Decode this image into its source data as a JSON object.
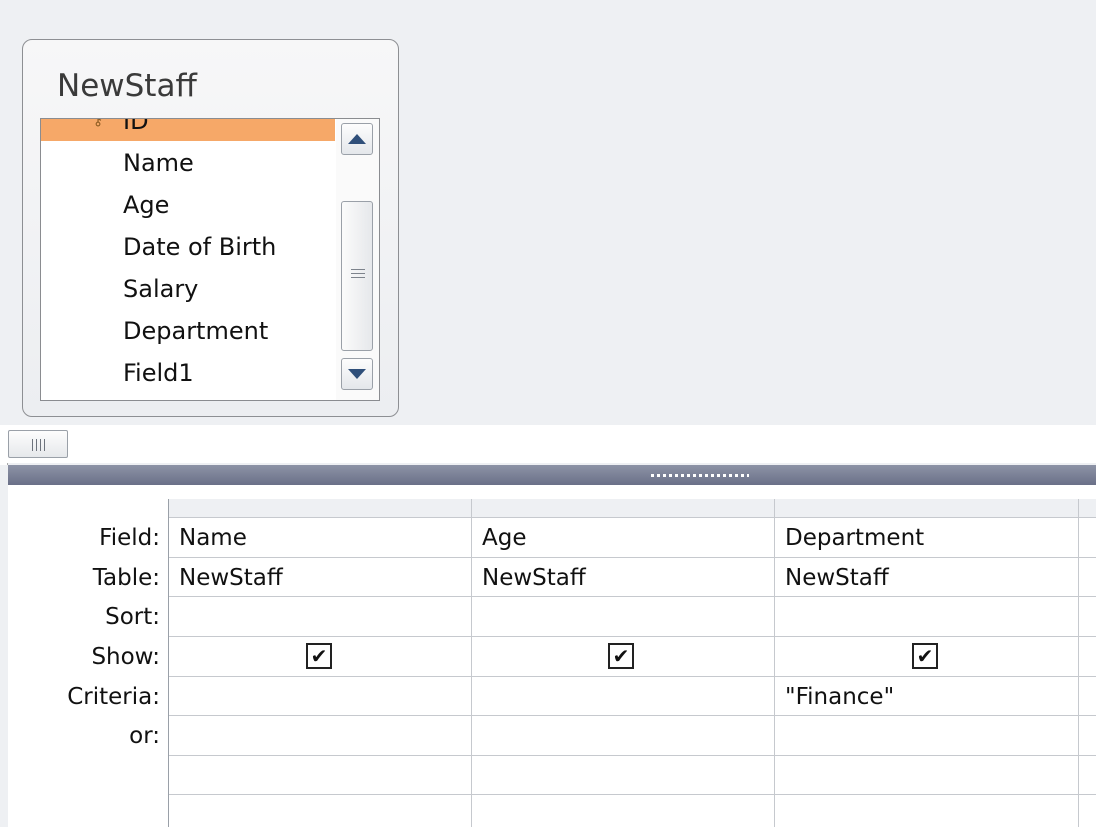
{
  "table_box": {
    "title": "NewStaff",
    "fields": [
      "ID",
      "Name",
      "Age",
      "Date of Birth",
      "Salary",
      "Department",
      "Field1"
    ],
    "selected_field": "ID"
  },
  "grid": {
    "row_labels": [
      "Field:",
      "Table:",
      "Sort:",
      "Show:",
      "Criteria:",
      "or:"
    ],
    "columns": [
      {
        "field": "Name",
        "table": "NewStaff",
        "sort": "",
        "show": true,
        "criteria": "",
        "or": ""
      },
      {
        "field": "Age",
        "table": "NewStaff",
        "sort": "",
        "show": true,
        "criteria": "",
        "or": ""
      },
      {
        "field": "Department",
        "table": "NewStaff",
        "sort": "",
        "show": true,
        "criteria": "\"Finance\"",
        "or": ""
      }
    ],
    "checkmark_glyph": "✔"
  },
  "colors": {
    "selected_field_bg": "#f6a868",
    "splitter": "#7a8098",
    "pane_bg": "#eef0f3"
  },
  "icons": [
    "key-icon",
    "scroll-up-icon",
    "scroll-down-icon",
    "scroll-grip-icon",
    "splitter-grip-icon",
    "checkmark-icon"
  ]
}
